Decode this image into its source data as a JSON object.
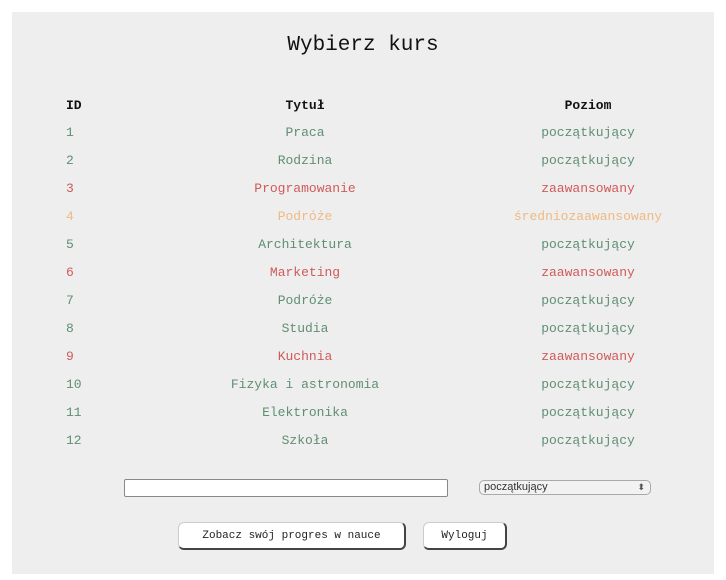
{
  "page": {
    "title": "Wybierz kurs"
  },
  "table": {
    "headers": {
      "id": "ID",
      "title": "Tytuł",
      "level": "Poziom"
    },
    "rows": [
      {
        "id": "1",
        "title": "Praca",
        "level": "początkujący",
        "status": "beginner"
      },
      {
        "id": "2",
        "title": "Rodzina",
        "level": "początkujący",
        "status": "beginner"
      },
      {
        "id": "3",
        "title": "Programowanie",
        "level": "zaawansowany",
        "status": "advanced"
      },
      {
        "id": "4",
        "title": "Podróże",
        "level": "średniozaawansowany",
        "status": "intermediate"
      },
      {
        "id": "5",
        "title": "Architektura",
        "level": "początkujący",
        "status": "beginner"
      },
      {
        "id": "6",
        "title": "Marketing",
        "level": "zaawansowany",
        "status": "advanced"
      },
      {
        "id": "7",
        "title": "Podróże",
        "level": "początkujący",
        "status": "beginner"
      },
      {
        "id": "8",
        "title": "Studia",
        "level": "początkujący",
        "status": "beginner"
      },
      {
        "id": "9",
        "title": "Kuchnia",
        "level": "zaawansowany",
        "status": "advanced"
      },
      {
        "id": "10",
        "title": "Fizyka i astronomia",
        "level": "początkujący",
        "status": "beginner"
      },
      {
        "id": "11",
        "title": "Elektronika",
        "level": "początkujący",
        "status": "beginner"
      },
      {
        "id": "12",
        "title": "Szkoła",
        "level": "początkujący",
        "status": "beginner"
      }
    ]
  },
  "form": {
    "search_value": "",
    "level_select_value": "początkujący"
  },
  "buttons": {
    "progress_label": "Zobacz swój progres w nauce",
    "logout_label": "Wyloguj"
  },
  "colors": {
    "beginner": "#5f8f72",
    "advanced": "#d05a5a",
    "intermediate": "#f0b982",
    "panel_background": "#eeeeee"
  },
  "icons": {
    "select_arrows": "up-down-chevron-icon"
  }
}
